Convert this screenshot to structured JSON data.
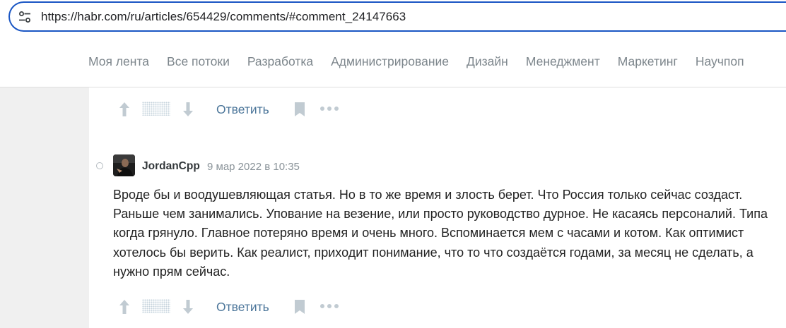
{
  "browser": {
    "url": "https://habr.com/ru/articles/654429/comments/#comment_24147663"
  },
  "nav": {
    "items": [
      "Моя лента",
      "Все потоки",
      "Разработка",
      "Администрирование",
      "Дизайн",
      "Менеджмент",
      "Маркетинг",
      "Научпоп"
    ]
  },
  "comment_top_actions": {
    "reply_label": "Ответить"
  },
  "comment": {
    "author": "JordanCpp",
    "timestamp": "9 мар 2022 в 10:35",
    "body": "Вроде бы и воодушевляющая статья. Но в то же время и злость берет. Что Россия только сейчас создаст. Раньше чем занимались. Упование на везение, или просто руководство дурное. Не касаясь персоналий. Типа когда грянуло. Главное потеряно время и очень много. Вспоминается мем с часами и котом. Как оптимист хотелось бы верить. Как реалист, приходит понимание, что то что создаётся годами, за месяц не сделать, а нужно прям сейчас.",
    "reply_label": "Ответить"
  },
  "icons": {
    "site_info": "tune-icon",
    "vote_up": "arrow-up-icon",
    "vote_down": "arrow-down-icon",
    "bookmark": "bookmark-icon",
    "more": "more-dots-icon"
  },
  "colors": {
    "url_focus_border": "#1a56c4",
    "nav_text": "#7d868c",
    "reply_link": "#4c769a",
    "icon_gray": "#c1cbd2"
  }
}
